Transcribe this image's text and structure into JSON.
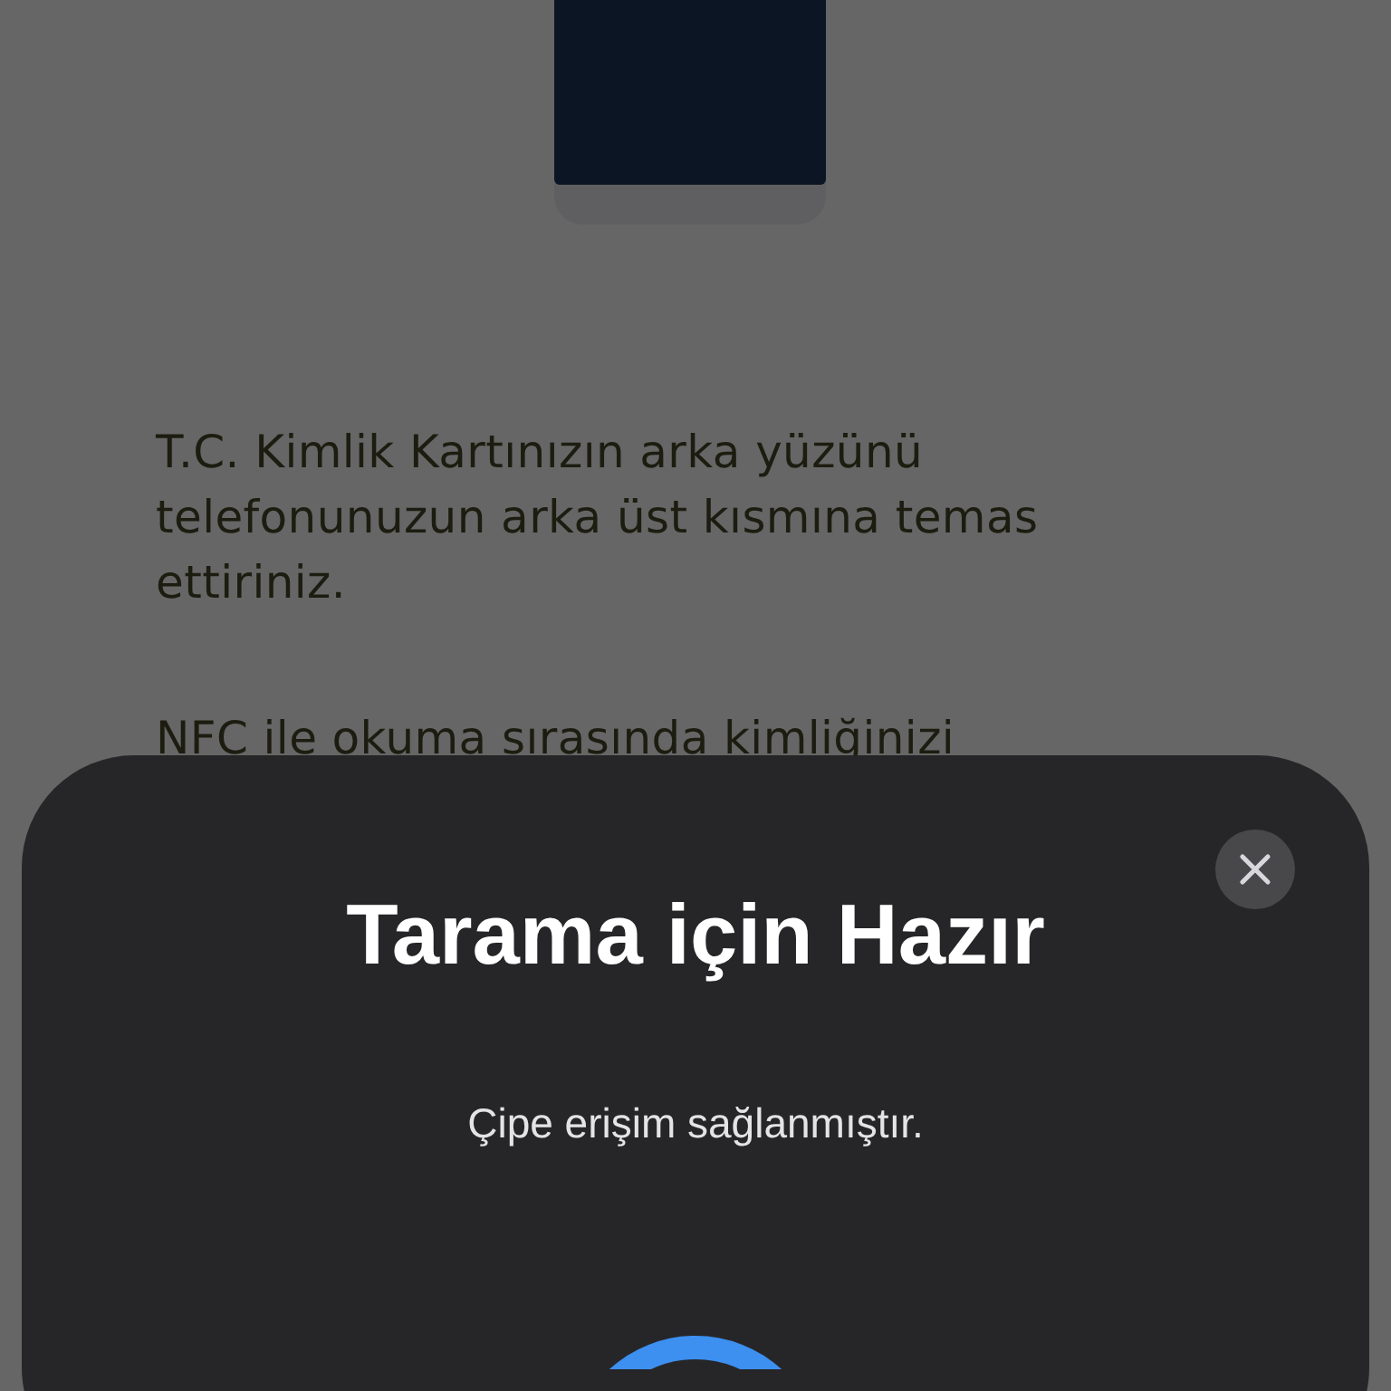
{
  "background": {
    "paragraphs": [
      "T.C. Kimlik Kartınızın arka yüzünü telefonunuzun arka üst kısmına temas ettiriniz.",
      "NFC ile okuma sırasında kimliğinizi"
    ]
  },
  "scan_sheet": {
    "title": "Tarama için Hazır",
    "message": "Çipe erişim sağlanmıştır."
  }
}
